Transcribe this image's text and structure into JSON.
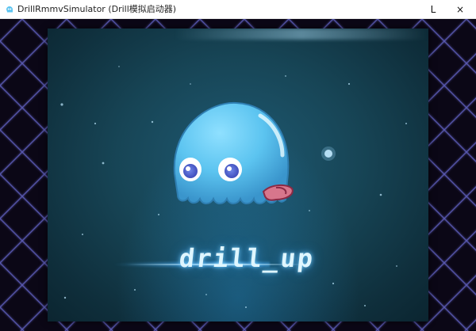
{
  "window": {
    "title": "DrillRmmvSimulator (Drill模拟启动器)",
    "minimize_glyph": "L",
    "close_glyph": "×",
    "app_icon": "blue-ghost-app-icon"
  },
  "splash": {
    "logo_text": "drill_up",
    "mascot": "blue-ghost-mascot-icon"
  },
  "colors": {
    "viewport_background": "#0b0716",
    "grid_lines": "#5a5ab4",
    "splash_background": "#174556",
    "mascot_body": "#5cc4f0",
    "logo_glow": "#78d2ff"
  }
}
